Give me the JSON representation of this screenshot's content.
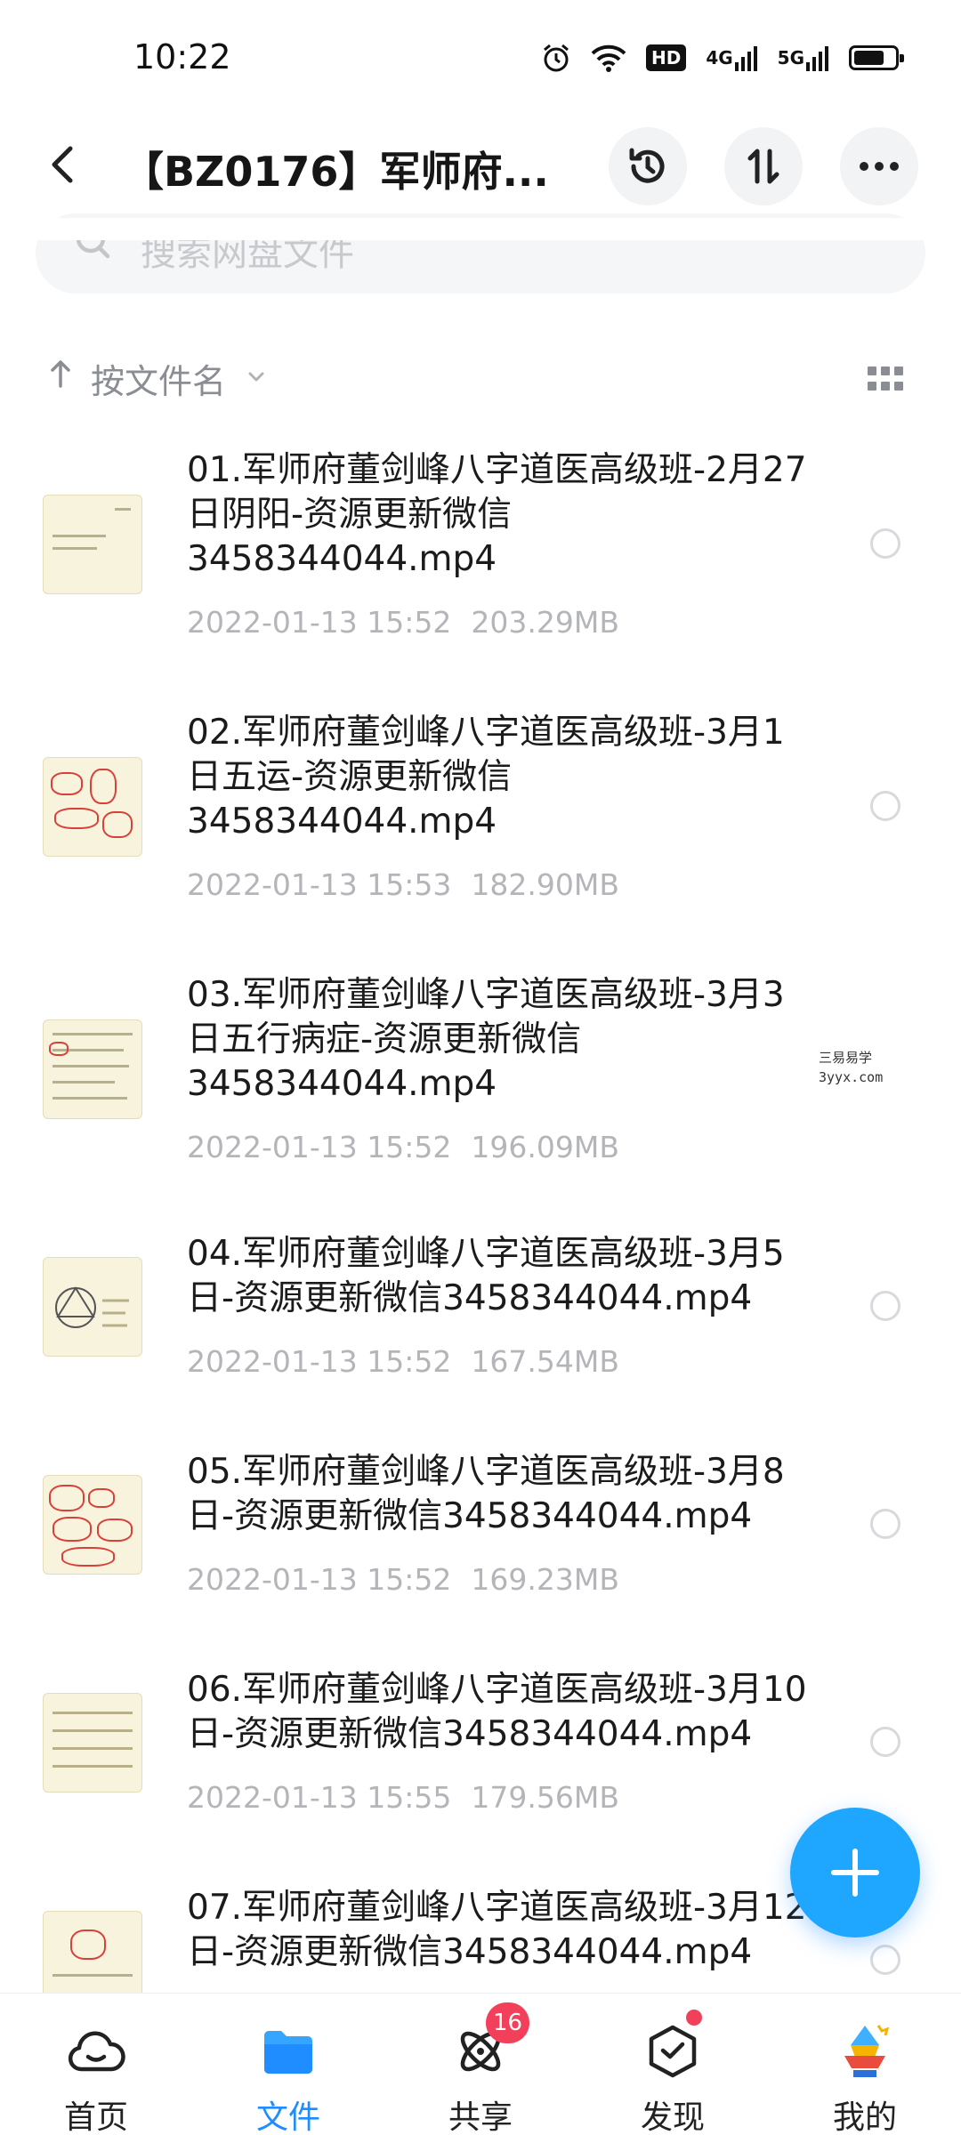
{
  "status_bar": {
    "time": "10:22",
    "icons": [
      "alarm-icon",
      "wifi-icon",
      "hd-icon",
      "4g-signal-icon",
      "5g-signal-icon",
      "battery-icon"
    ],
    "hd": "HD",
    "net_4g": "4G",
    "net_5g": "5G",
    "battery_level": 0.75
  },
  "header": {
    "title": "【BZ0176】军师府...",
    "actions": [
      "history-icon",
      "sort-icon",
      "more-icon"
    ]
  },
  "search": {
    "placeholder": "搜索网盘文件"
  },
  "sort": {
    "label": "按文件名"
  },
  "files": [
    {
      "name": "01.军师府董剑峰八字道医高级班-2月27日阴阳-资源更新微信3458344044.mp4",
      "date": "2022-01-13  15:52",
      "size": "203.29MB"
    },
    {
      "name": "02.军师府董剑峰八字道医高级班-3月1日五运-资源更新微信3458344044.mp4",
      "date": "2022-01-13  15:53",
      "size": "182.90MB"
    },
    {
      "name": "03.军师府董剑峰八字道医高级班-3月3日五行病症-资源更新微信3458344044.mp4",
      "date": "2022-01-13  15:52",
      "size": "196.09MB"
    },
    {
      "name": "04.军师府董剑峰八字道医高级班-3月5日-资源更新微信3458344044.mp4",
      "date": "2022-01-13  15:52",
      "size": "167.54MB"
    },
    {
      "name": "05.军师府董剑峰八字道医高级班-3月8日-资源更新微信3458344044.mp4",
      "date": "2022-01-13  15:52",
      "size": "169.23MB"
    },
    {
      "name": "06.军师府董剑峰八字道医高级班-3月10日-资源更新微信3458344044.mp4",
      "date": "2022-01-13  15:55",
      "size": "179.56MB"
    },
    {
      "name": "07.军师府董剑峰八字道医高级班-3月12日-资源更新微信3458344044.mp4",
      "date": "",
      "size": ""
    }
  ],
  "watermark": {
    "line1": "三易易学",
    "line2": "3yyx.com"
  },
  "bottom_nav": {
    "items": [
      {
        "label": "首页",
        "icon": "home-cloud-icon"
      },
      {
        "label": "文件",
        "icon": "folder-icon",
        "active": true
      },
      {
        "label": "共享",
        "icon": "share-orbit-icon",
        "badge": "16"
      },
      {
        "label": "发现",
        "icon": "discover-box-icon",
        "dot": true
      },
      {
        "label": "我的",
        "icon": "avatar-icon"
      }
    ]
  },
  "colors": {
    "accent": "#1f8cff",
    "fab": "#1fa7ff",
    "badge": "#f2405a",
    "meta_text": "#b3b5b9"
  }
}
